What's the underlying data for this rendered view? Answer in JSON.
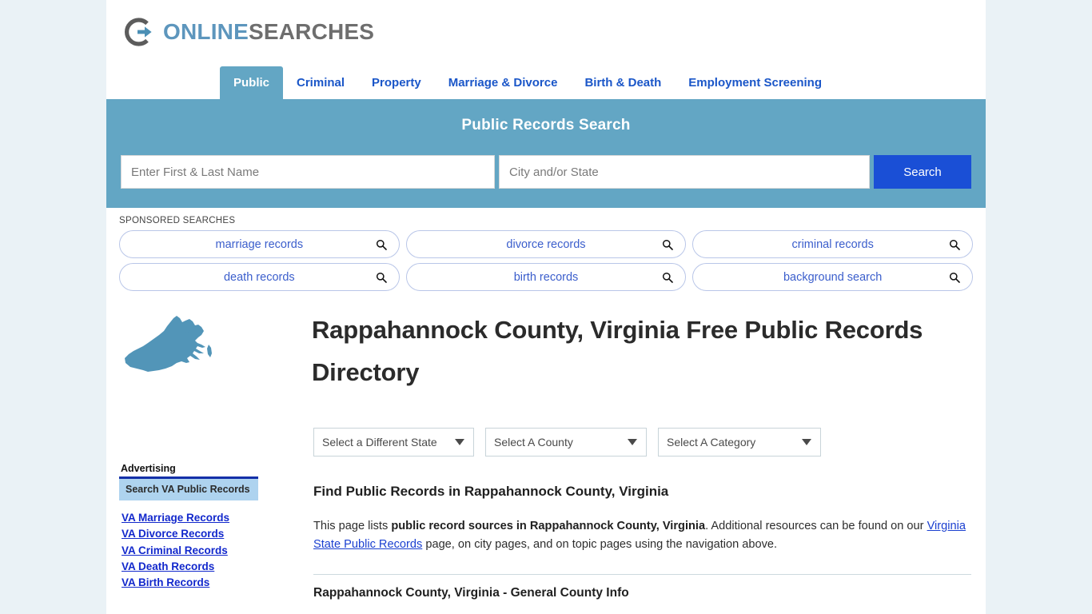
{
  "site": {
    "logo_primary": "ONLINE",
    "logo_secondary": "SEARCHES",
    "logo_primary_color": "#5d96bd",
    "logo_secondary_color": "#6e6e6e"
  },
  "nav": {
    "items": [
      {
        "label": "Public",
        "active": true
      },
      {
        "label": "Criminal",
        "active": false
      },
      {
        "label": "Property",
        "active": false
      },
      {
        "label": "Marriage & Divorce",
        "active": false
      },
      {
        "label": "Birth & Death",
        "active": false
      },
      {
        "label": "Employment Screening",
        "active": false
      }
    ]
  },
  "search_banner": {
    "title": "Public Records Search",
    "name_placeholder": "Enter First & Last Name",
    "name_value": "",
    "location_placeholder": "City and/or State",
    "location_value": "",
    "button_label": "Search",
    "background_color": "#63a6c4",
    "button_color": "#1a4fd6"
  },
  "sponsored": {
    "label": "SPONSORED SEARCHES",
    "items": [
      {
        "label": "marriage records",
        "icon": "search-icon"
      },
      {
        "label": "divorce records",
        "icon": "search-icon"
      },
      {
        "label": "criminal records",
        "icon": "search-icon"
      },
      {
        "label": "death records",
        "icon": "search-icon"
      },
      {
        "label": "birth records",
        "icon": "search-icon"
      },
      {
        "label": "background search",
        "icon": "search-icon"
      }
    ]
  },
  "page": {
    "title": "Rappahannock County, Virginia Free Public Records Directory",
    "state_map_icon": "virginia-state-map-icon",
    "state_map_color": "#5295b8"
  },
  "filters": {
    "state": {
      "label": "Select a Different State",
      "caret": "chevron-down-icon"
    },
    "county": {
      "label": "Select A County",
      "caret": "chevron-down-icon"
    },
    "category": {
      "label": "Select A Category",
      "caret": "chevron-down-icon"
    }
  },
  "article": {
    "heading": "Find Public Records in Rappahannock County, Virginia",
    "paragraph": {
      "part1": "This page lists ",
      "bold1": "public record sources in Rappahannock County, Virginia",
      "part2": ". Additional resources can be found on our ",
      "link": "Virginia State Public Records",
      "part3": " page, on city pages, and on topic pages using the navigation above."
    },
    "subsection_heading": "Rappahannock County, Virginia - General County Info"
  },
  "sidebar": {
    "advertising_label": "Advertising",
    "promo_box_label": "Search VA Public Records",
    "promo_box_color": "#aed3ef",
    "promo_box_border_color": "#1430a8",
    "links": [
      {
        "label": "VA Marriage Records"
      },
      {
        "label": "VA Divorce Records"
      },
      {
        "label": "VA Criminal Records"
      },
      {
        "label": "VA Death Records"
      },
      {
        "label": "VA Birth Records"
      }
    ]
  }
}
